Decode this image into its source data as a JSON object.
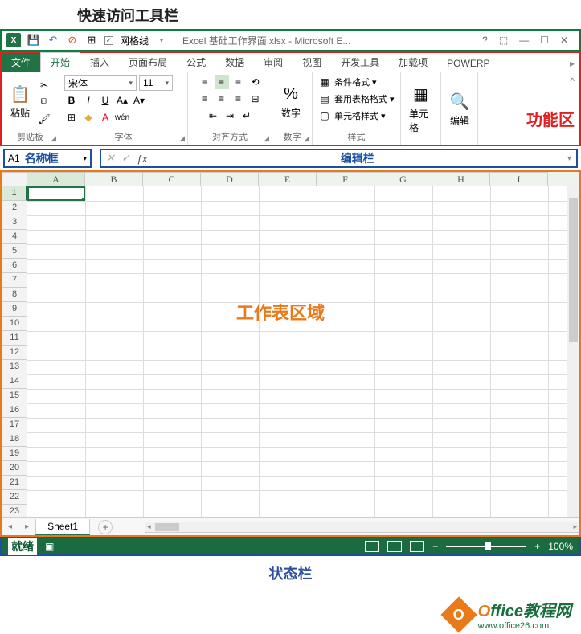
{
  "annotations": {
    "qat": "快速访问工具栏",
    "ribbon": "功能区",
    "namebox": "名称框",
    "formulabar": "编辑栏",
    "worksheet": "工作表区域",
    "statusbar": "状态栏"
  },
  "title": "Excel 基础工作界面.xlsx - Microsoft E...",
  "qat": {
    "gridlines_label": "网格线"
  },
  "tabs": {
    "file": "文件",
    "home": "开始",
    "insert": "插入",
    "layout": "页面布局",
    "formulas": "公式",
    "data": "数据",
    "review": "审阅",
    "view": "视图",
    "developer": "开发工具",
    "addins": "加载项",
    "powerp": "POWERP"
  },
  "ribbon": {
    "clipboard": {
      "label": "剪贴板",
      "paste": "粘贴"
    },
    "font": {
      "label": "字体",
      "name": "宋体",
      "size": "11"
    },
    "align": {
      "label": "对齐方式"
    },
    "number": {
      "label": "数字",
      "btn": "数字"
    },
    "styles": {
      "label": "样式",
      "cond": "条件格式",
      "table": "套用表格格式",
      "cell": "单元格样式"
    },
    "cells": {
      "label": "单元格"
    },
    "editing": {
      "label": "编辑"
    }
  },
  "namebox_value": "A1",
  "columns": [
    "A",
    "B",
    "C",
    "D",
    "E",
    "F",
    "G",
    "H",
    "I"
  ],
  "rows": [
    1,
    2,
    3,
    4,
    5,
    6,
    7,
    8,
    9,
    10,
    11,
    12,
    13,
    14,
    15,
    16,
    17,
    18,
    19,
    20,
    21,
    22,
    23
  ],
  "sheet": {
    "name": "Sheet1"
  },
  "status": {
    "ready": "就绪",
    "zoom": "100%"
  },
  "footer": {
    "brand_o": "O",
    "brand_rest": "ffice教程网",
    "url": "www.office26.com"
  }
}
